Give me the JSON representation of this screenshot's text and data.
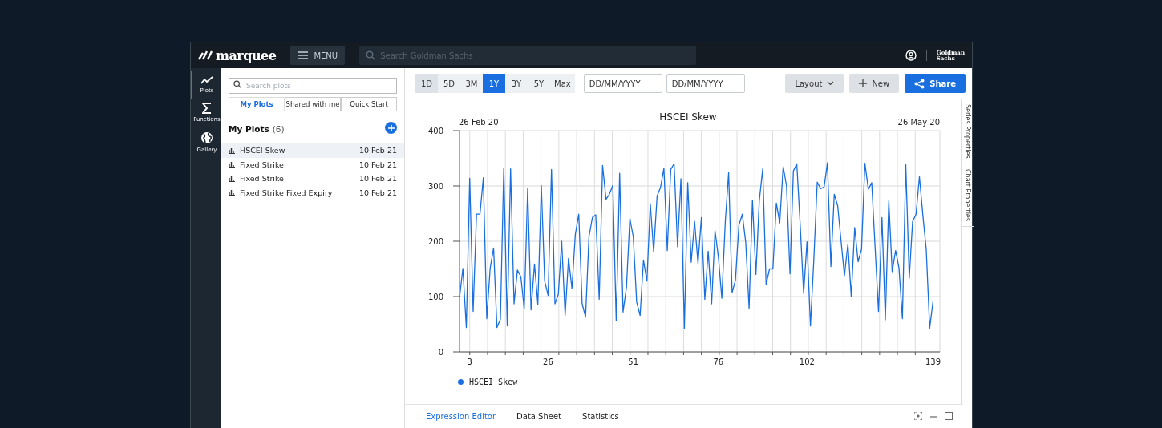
{
  "header": {
    "logo": "marquee",
    "menu_button": "MENU",
    "search": {
      "placeholder": "Search Goldman Sachs"
    },
    "brand_lines": [
      "Goldman",
      "Sachs"
    ]
  },
  "rail": [
    {
      "label": "Plots",
      "selected": true
    },
    {
      "label": "Functions",
      "selected": false
    },
    {
      "label": "Gallery",
      "selected": false
    }
  ],
  "plots_panel": {
    "search": {
      "placeholder": "Search plots"
    },
    "tabs": [
      {
        "label": "My Plots",
        "selected": true
      },
      {
        "label": "Shared with me",
        "selected": false
      },
      {
        "label": "Quick Start",
        "selected": false
      }
    ],
    "heading": "My Plots",
    "count": "(6)",
    "items": [
      {
        "name": "HSCEI Skew",
        "date": "10 Feb 21",
        "selected": true
      },
      {
        "name": "Fixed Strike",
        "date": "10 Feb 21",
        "selected": false
      },
      {
        "name": "Fixed Strike",
        "date": "10 Feb 21",
        "selected": false
      },
      {
        "name": "Fixed Strike Fixed Expiry",
        "date": "10 Feb 21",
        "selected": false
      }
    ]
  },
  "toolbar": {
    "ranges": [
      {
        "label": "1D",
        "selected": false
      },
      {
        "label": "5D",
        "selected": false
      },
      {
        "label": "3M",
        "selected": false
      },
      {
        "label": "1Y",
        "selected": true
      },
      {
        "label": "3Y",
        "selected": false
      },
      {
        "label": "5Y",
        "selected": false
      },
      {
        "label": "Max",
        "selected": false
      }
    ],
    "date_fields": [
      {
        "placeholder": "DD/MM/YYYY"
      },
      {
        "placeholder": "DD/MM/YYYY"
      }
    ],
    "layout_button": "Layout",
    "new_button": "New",
    "share_button": "Share"
  },
  "chart": {
    "chart_data": {
      "type": "line",
      "title": "HSCEI Skew",
      "x": [
        0,
        1,
        2,
        3,
        4,
        5,
        6,
        7,
        8,
        9,
        10,
        11,
        12,
        13,
        14,
        15,
        16,
        17,
        18,
        19,
        20,
        21,
        22,
        23,
        24,
        25,
        26,
        27,
        28,
        29,
        30,
        31,
        32,
        33,
        34,
        35,
        36,
        37,
        38,
        39,
        40,
        41,
        42,
        43,
        44,
        45,
        46,
        47,
        48,
        49,
        50,
        51,
        52,
        53,
        54,
        55,
        56,
        57,
        58,
        59,
        60,
        61,
        62,
        63,
        64,
        65,
        66,
        67,
        68,
        69,
        70,
        71,
        72,
        73,
        74,
        75,
        76,
        77,
        78,
        79,
        80,
        81,
        82,
        83,
        84,
        85,
        86,
        87,
        88,
        89,
        90,
        91,
        92,
        93,
        94,
        95,
        96,
        97,
        98,
        99,
        100,
        101,
        102,
        103,
        104,
        105,
        106,
        107,
        108,
        109,
        110,
        111,
        112,
        113,
        114,
        115,
        116,
        117,
        118,
        119,
        120,
        121,
        122,
        123,
        124,
        125,
        126,
        127,
        128,
        129,
        130,
        131,
        132,
        133,
        134,
        135,
        136,
        137,
        138,
        139
      ],
      "series": [
        {
          "name": "HSCEI Skew",
          "color": "#1a6fe0",
          "values": [
            98,
            151,
            44,
            314,
            73,
            249,
            249,
            315,
            60,
            151,
            188,
            44,
            59,
            332,
            47,
            331,
            87,
            148,
            136,
            78,
            295,
            76,
            159,
            86,
            301,
            128,
            102,
            330,
            87,
            104,
            200,
            66,
            169,
            115,
            212,
            249,
            87,
            63,
            208,
            243,
            248,
            95,
            337,
            276,
            285,
            301,
            56,
            323,
            72,
            117,
            241,
            208,
            90,
            66,
            166,
            128,
            268,
            181,
            282,
            297,
            332,
            183,
            330,
            340,
            190,
            313,
            42,
            306,
            162,
            236,
            160,
            243,
            95,
            182,
            87,
            219,
            170,
            97,
            235,
            324,
            107,
            130,
            229,
            249,
            198,
            79,
            274,
            140,
            273,
            331,
            122,
            150,
            150,
            269,
            233,
            335,
            300,
            141,
            327,
            340,
            230,
            106,
            199,
            47,
            166,
            307,
            295,
            298,
            342,
            154,
            285,
            264,
            200,
            138,
            195,
            100,
            225,
            163,
            185,
            341,
            294,
            306,
            187,
            73,
            243,
            58,
            273,
            145,
            183,
            152,
            60,
            339,
            133,
            236,
            249,
            317,
            247,
            185,
            43,
            92
          ]
        }
      ],
      "grid": true,
      "xlim": [
        0,
        141
      ],
      "ylim": [
        0,
        400
      ],
      "yticks": [
        0,
        100,
        200,
        300,
        400
      ],
      "xticks": [
        3,
        26,
        51,
        76,
        102,
        139
      ],
      "annotations": [
        "26 Feb 20",
        "26 May 20"
      ]
    }
  },
  "side_tabs": [
    "Series Properties",
    "Chart Properties"
  ],
  "bottom_tabs": [
    {
      "label": "Expression Editor",
      "selected": true
    },
    {
      "label": "Data Sheet",
      "selected": false
    },
    {
      "label": "Statistics",
      "selected": false
    }
  ]
}
